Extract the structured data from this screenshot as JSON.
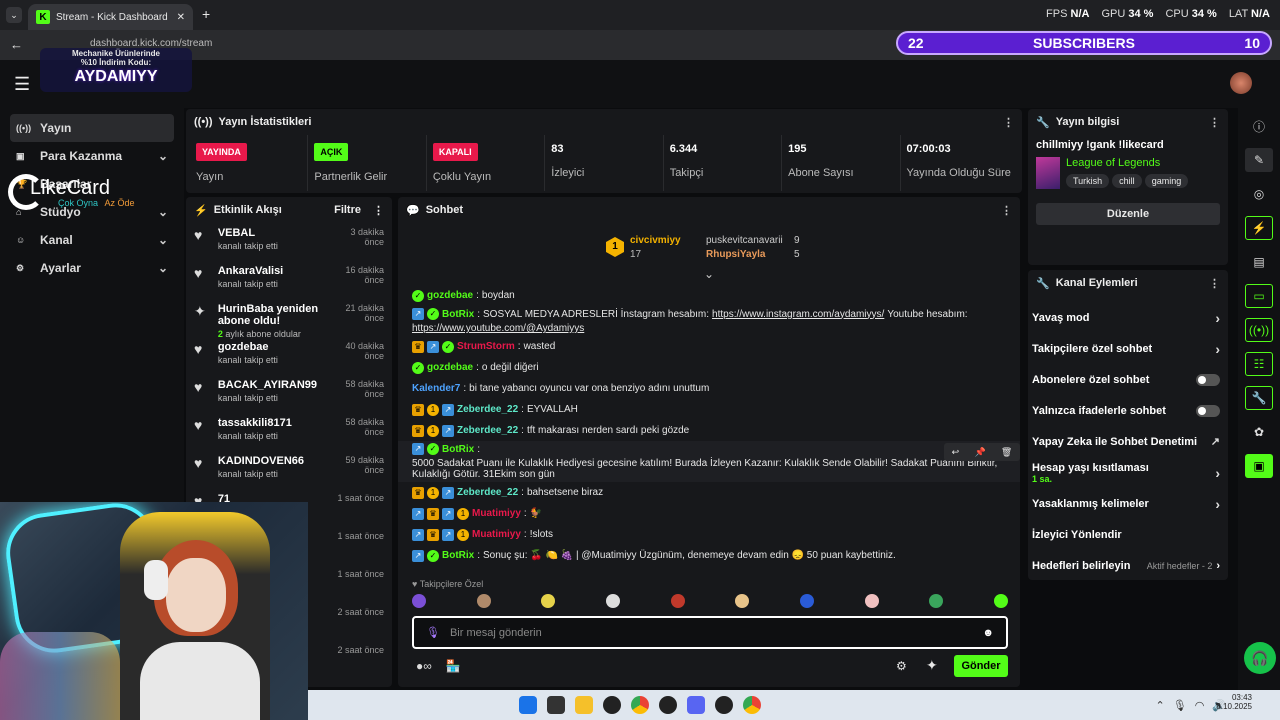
{
  "browser": {
    "tab_title": "Stream - Kick Dashboard",
    "url": "dashboard.kick.com/stream",
    "perf": [
      {
        "label": "FPS",
        "value": "N/A"
      },
      {
        "label": "GPU",
        "value": "34 %"
      },
      {
        "label": "CPU",
        "value": "34 %"
      },
      {
        "label": "LAT",
        "value": "N/A"
      }
    ]
  },
  "overlay": {
    "subs_left": "22",
    "subs_label": "SUBSCRIBERS",
    "subs_right": "10",
    "promo_line1": "Mechanike Ürünlerinde",
    "promo_line2": "%10 İndirim Kodu:",
    "promo_code": "AYDAMIYY",
    "likecard": "LikeCard",
    "likecard_sub1": "Çok Oyna",
    "likecard_sub2": "Az Öde"
  },
  "sidebar": {
    "items": [
      {
        "label": "Yayın",
        "icon": "broadcast-icon",
        "active": true
      },
      {
        "label": "Para Kazanma",
        "icon": "money-icon",
        "chev": true
      },
      {
        "label": "Başarılar",
        "icon": "trophy-icon"
      },
      {
        "label": "Stüdyo",
        "icon": "studio-icon",
        "chev": true
      },
      {
        "label": "Kanal",
        "icon": "channel-icon",
        "chev": true
      },
      {
        "label": "Ayarlar",
        "icon": "gear-icon",
        "chev": true
      }
    ]
  },
  "stats": {
    "title": "Yayın İstatistikleri",
    "items": [
      {
        "badge": "YAYINDA",
        "badge_color": "#e8194b",
        "label": "Yayın"
      },
      {
        "badge": "AÇIK",
        "badge_color": "#53fc18",
        "label": "Partnerlik Gelir"
      },
      {
        "badge": "KAPALI",
        "badge_color": "#e8194b",
        "label": "Çoklu Yayın"
      },
      {
        "value": "83",
        "label": "İzleyici"
      },
      {
        "value": "6.344",
        "label": "Takipçi"
      },
      {
        "value": "195",
        "label": "Abone Sayısı"
      },
      {
        "value": "07:00:03",
        "label": "Yayında Olduğu Süre"
      }
    ]
  },
  "info": {
    "title": "Yayın bilgisi",
    "stream_title": "chillmiyy !gank !likecard",
    "game": "League of Legends",
    "tags": [
      "Turkish",
      "chill",
      "gaming"
    ],
    "edit_label": "Düzenle"
  },
  "activity": {
    "title": "Etkinlik Akışı",
    "filter_label": "Filtre",
    "items": [
      {
        "name": "VEBAL",
        "sub": "kanalı takip etti",
        "time": "3 dakika önce"
      },
      {
        "name": "AnkaraValisi",
        "sub": "kanalı takip etti",
        "time": "16 dakika önce"
      },
      {
        "name": "HurinBaba yeniden abone oldu!",
        "sub": "aylık abone oldular",
        "sub_num": "2",
        "time": "21 dakika önce",
        "star": true
      },
      {
        "name": "gozdebae",
        "sub": "kanalı takip etti",
        "time": "40 dakika önce"
      },
      {
        "name": "BACAK_AYIRAN99",
        "sub": "kanalı takip etti",
        "time": "58 dakika önce"
      },
      {
        "name": "tassakkili8171",
        "sub": "kanalı takip etti",
        "time": "58 dakika önce"
      },
      {
        "name": "KADINDOVEN66",
        "sub": "kanalı takip etti",
        "time": "59 dakika önce"
      },
      {
        "name": "71",
        "sub": "",
        "time": "1 saat önce"
      },
      {
        "name": "",
        "sub": "",
        "time": "1 saat önce"
      },
      {
        "name": "",
        "sub": "",
        "time": "1 saat önce"
      },
      {
        "name": "",
        "sub": "",
        "time": "2 saat önce"
      },
      {
        "name": "",
        "sub": "",
        "time": "2 saat önce"
      }
    ]
  },
  "chat": {
    "title": "Sohbet",
    "top": [
      {
        "name": "civcivmiyy",
        "count": "17"
      },
      {
        "name": "puskevitcanavarii",
        "count": "9"
      },
      {
        "name": "RhupsiYayla",
        "count": "5"
      }
    ],
    "messages": [
      {
        "badges": [
          "ig"
        ],
        "user": "gozdebae",
        "color": "#53fc18",
        "text": "boydan"
      },
      {
        "badges": [
          "ib",
          "ig"
        ],
        "user": "BotRix",
        "color": "#53fc18",
        "text": "SOSYAL MEDYA ADRESLERİ İnstagram hesabım: ",
        "link1": "https://www.instagram.com/aydamiyys/",
        "text2": " Youtube hesabım:",
        "link2": "https://www.youtube.com/@Aydamiyys"
      },
      {
        "badges": [
          "ic2",
          "ib",
          "ig"
        ],
        "user": "StrumStorm",
        "color": "#e8194b",
        "text": "wasted"
      },
      {
        "badges": [
          "ig"
        ],
        "user": "gozdebae",
        "color": "#53fc18",
        "text": "o değil diğeri"
      },
      {
        "badges": [],
        "user": "Kalender7",
        "color": "#4ea3ff",
        "text": "bi tane yabancı oyuncu var ona benziyo adını unuttum"
      },
      {
        "badges": [
          "ic2",
          "iy",
          "ib"
        ],
        "user": "Zeberdee_22",
        "color": "#5ee8c8",
        "text": "EYVALLAH"
      },
      {
        "badges": [
          "ic2",
          "iy",
          "ib"
        ],
        "user": "Zeberdee_22",
        "color": "#5ee8c8",
        "text": "tft makarası nerden sardı peki gözde"
      },
      {
        "badges": [
          "ib",
          "ig"
        ],
        "user": "BotRix",
        "color": "#53fc18",
        "text": "5000 Sadakat Puanı ile Kulaklık Hediyesi gecesine katılım! Burada İzleyen Kazanır: Kulaklık Sende Olabilir! Sadakat Puanını Biriktir, Kulaklığı Götür. 31Ekim son gün"
      },
      {
        "badges": [
          "ic2",
          "iy",
          "ib"
        ],
        "user": "Zeberdee_22",
        "color": "#5ee8c8",
        "text": "bahsetsene biraz"
      },
      {
        "badges": [
          "ib",
          "ic2",
          "ib",
          "iy"
        ],
        "user": "Muatimiyy",
        "color": "#e8194b",
        "text": "🐓"
      },
      {
        "badges": [
          "ib",
          "ic2",
          "ib",
          "iy"
        ],
        "user": "Muatimiyy",
        "color": "#e8194b",
        "text": "!slots"
      },
      {
        "badges": [
          "ib",
          "ig"
        ],
        "user": "BotRix",
        "color": "#53fc18",
        "text": "Sonuç şu: 🍒 🍋 🍇 | @Muatimiyy Üzgünüm, denemeye devam edin 😞 50 puan kaybettiniz."
      }
    ],
    "followers_only": "Takipçilere Özel",
    "placeholder": "Bir mesaj gönderin",
    "send_label": "Gönder"
  },
  "actions": {
    "title": "Kanal Eylemleri",
    "items": [
      {
        "label": "Yavaş mod",
        "kind": "chev"
      },
      {
        "label": "Takipçilere özel sohbet",
        "kind": "chev"
      },
      {
        "label": "Abonelere özel sohbet",
        "kind": "toggle"
      },
      {
        "label": "Yalnızca ifadelerle sohbet",
        "kind": "toggle"
      },
      {
        "label": "Yapay Zeka ile Sohbet Denetimi",
        "kind": "ext"
      },
      {
        "label": "Hesap yaşı kısıtlaması",
        "sub": "1 sa.",
        "kind": "chev"
      },
      {
        "label": "Yasaklanmış kelimeler",
        "kind": "chev"
      },
      {
        "label": "İzleyici Yönlendir",
        "kind": "none"
      },
      {
        "label": "Hedefleri belirleyin",
        "extra": "Aktif hedefler - 2",
        "kind": "chev"
      }
    ]
  },
  "taskbar": {
    "time": "03:43",
    "date": "8.10.2025"
  }
}
